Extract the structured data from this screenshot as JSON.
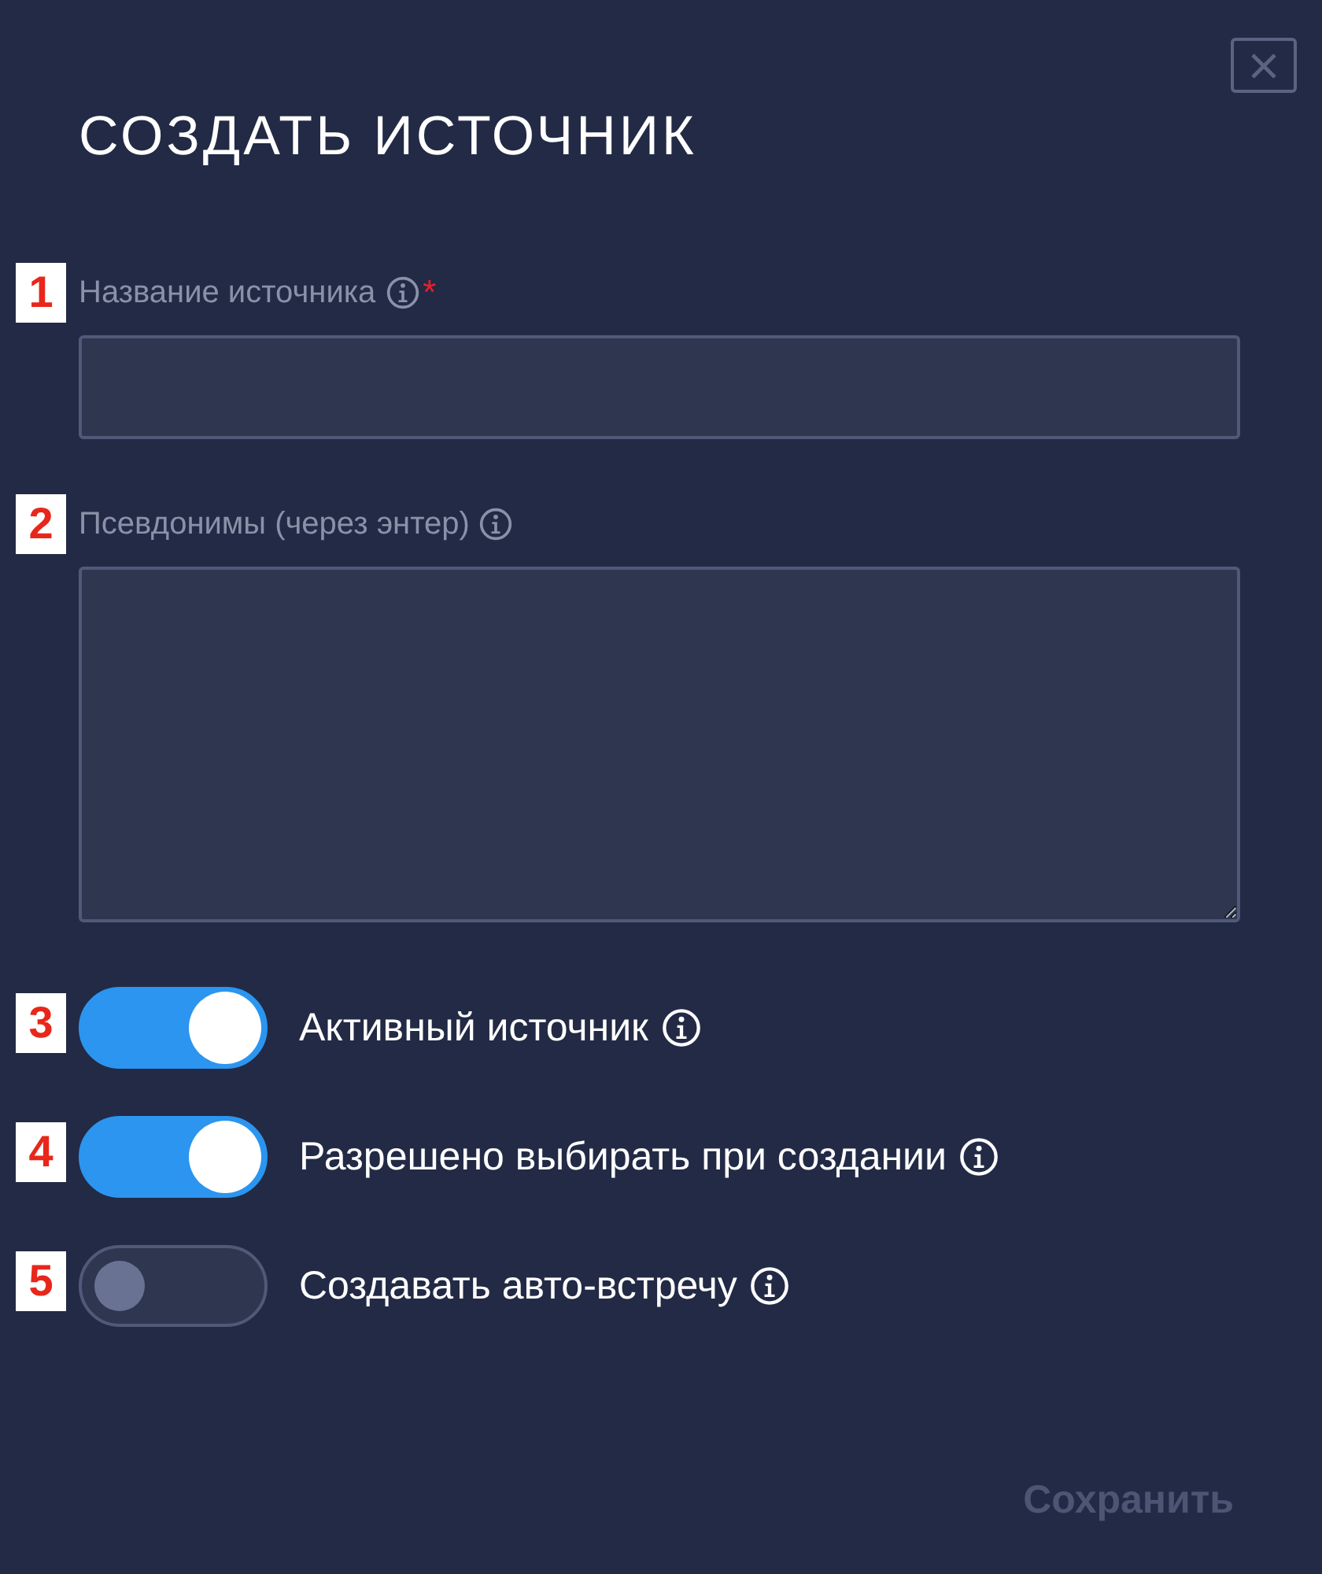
{
  "dialog": {
    "title": "СОЗДАТЬ ИСТОЧНИК"
  },
  "fields": [
    {
      "marker": "1",
      "label": "Название источника",
      "required_mark": "*",
      "kind": "input"
    },
    {
      "marker": "2",
      "label": "Псевдонимы (через энтер)",
      "kind": "textarea"
    }
  ],
  "toggles": [
    {
      "marker": "3",
      "label": "Активный источник",
      "on": true
    },
    {
      "marker": "4",
      "label": "Разрешено выбирать при создании",
      "on": true
    },
    {
      "marker": "5",
      "label": "Создавать авто-встречу",
      "on": false
    }
  ],
  "save_button": {
    "label": "Сохранить",
    "disabled": true
  }
}
